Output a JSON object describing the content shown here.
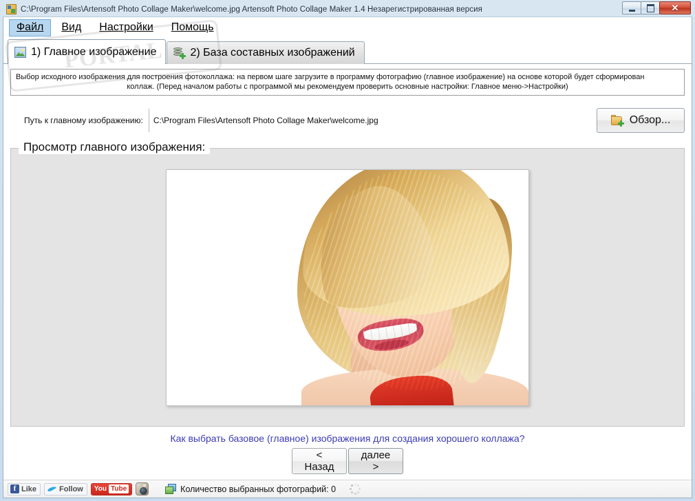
{
  "window": {
    "title": "C:\\Program Files\\Artensoft Photo Collage Maker\\welcome.jpg Artensoft Photo Collage Maker 1.4  Незарегистрированная версия",
    "icon": "app-icon",
    "controls": {
      "minimize": "minimize-button",
      "maximize": "maximize-button",
      "close_label": "✕"
    }
  },
  "menu": {
    "items": [
      {
        "label": "Файл",
        "active": true
      },
      {
        "label": "Вид",
        "active": false
      },
      {
        "label": "Настройки",
        "active": false
      },
      {
        "label": "Помощь",
        "active": false
      }
    ]
  },
  "tabs": [
    {
      "label": "1) Главное изображение",
      "icon": "picture-icon",
      "selected": true
    },
    {
      "label": "2) База составных изображений",
      "icon": "database-add-icon",
      "selected": false
    }
  ],
  "hint": {
    "line1": "Выбор исходного изображения для построения фотоколлажа: на первом шаге загрузите в программу фотографию (главное изображение) на основе которой будет сформирован",
    "line2": "коллаж. (Перед началом работы с программой мы рекомендуем проверить основные настройки: Главное меню->Настройки)"
  },
  "path_row": {
    "label": "Путь к главному изображению:",
    "value": "C:\\Program Files\\Artensoft Photo Collage Maker\\welcome.jpg",
    "placeholder": "",
    "browse_label": "Обзор...",
    "browse_icon": "folder-add-icon"
  },
  "preview": {
    "group_title": "Просмотр главного изображения:",
    "image_alt": "Портрет улыбающейся блондинки на белом фоне",
    "background_color": "#e4e4e4"
  },
  "help_link": {
    "text": "Как выбрать базовое (главное) изображения для создания хорошего коллажа?",
    "color": "#3b3bb5"
  },
  "nav": {
    "back": {
      "top": "<",
      "bottom": "Назад"
    },
    "next": {
      "top": "далее",
      "bottom": ">"
    }
  },
  "statusbar": {
    "facebook": {
      "glyph": "f",
      "label": "Like"
    },
    "twitter": {
      "label": "Follow"
    },
    "youtube": {
      "word": "You",
      "box": "Tube"
    },
    "instagram": {
      "name": "instagram-icon"
    },
    "count_icon": "photos-icon",
    "count_text": "Количество выбранных фотографий: 0",
    "spinner": "loading-spinner"
  },
  "watermark": {
    "text": "PORTAL"
  },
  "colors": {
    "titlebar_gradient_top": "#d8e6f2",
    "accent_blue": "#b7d7f0",
    "close_red": "#c9271c",
    "link_blue": "#3b3bb5",
    "preview_bg": "#e4e4e4"
  }
}
